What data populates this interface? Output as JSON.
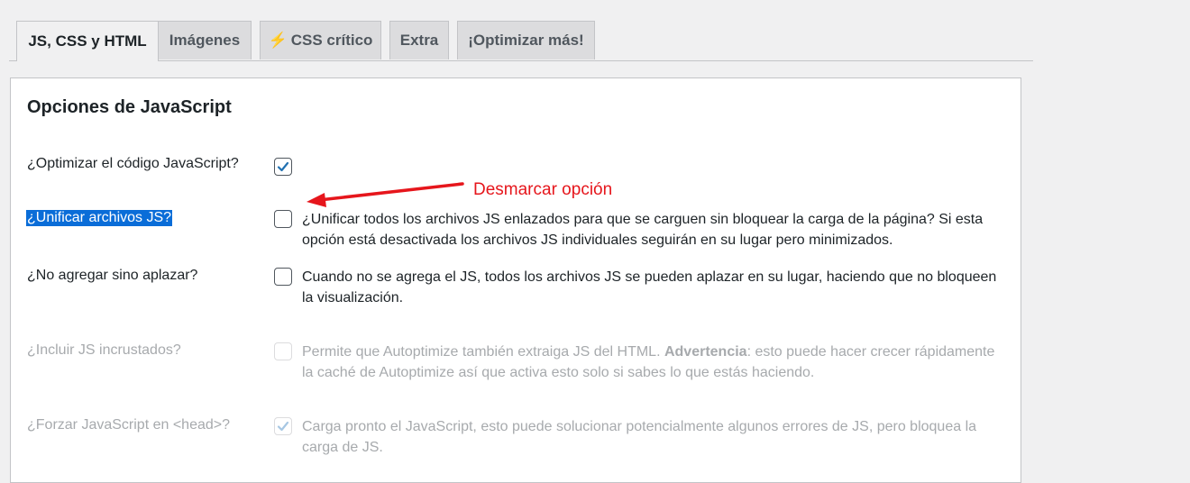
{
  "tabs": [
    {
      "label": "JS, CSS y HTML",
      "active": true
    },
    {
      "label": "Imágenes",
      "active": false
    },
    {
      "label": "CSS crítico",
      "icon": "lightning-bolt-icon",
      "active": false
    },
    {
      "label": "Extra",
      "active": false
    },
    {
      "label": "¡Optimizar más!",
      "active": false
    }
  ],
  "panel": {
    "title": "Opciones de JavaScript",
    "options": [
      {
        "label": "¿Optimizar el código JavaScript?",
        "checked": true,
        "disabled": false,
        "description": ""
      },
      {
        "label": "¿Unificar archivos JS?",
        "checked": false,
        "disabled": false,
        "selected": true,
        "description": "¿Unificar todos los archivos JS enlazados para que se carguen sin bloquear la carga de la página? Si esta opción está desactivada los archivos JS individuales seguirán en su lugar pero minimizados."
      },
      {
        "label": "¿No agregar sino aplazar?",
        "checked": false,
        "disabled": false,
        "description": "Cuando no se agrega el JS, todos los archivos JS se pueden aplazar en su lugar, haciendo que no bloqueen la visualización."
      },
      {
        "label": "¿Incluir JS incrustados?",
        "checked": false,
        "disabled": true,
        "description_before": "Permite que Autoptimize también extraiga JS del HTML. ",
        "description_bold": "Advertencia",
        "description_after": ": esto puede hacer crecer rápidamente la caché de Autoptimize así que activa esto solo si sabes lo que estás haciendo."
      },
      {
        "label": "¿Forzar JavaScript en <head>?",
        "checked": true,
        "disabled": true,
        "description": "Carga pronto el JavaScript, esto puede solucionar potencialmente algunos errores de JS, pero bloquea la carga de JS."
      }
    ]
  },
  "annotation": {
    "text": "Desmarcar opción",
    "color": "#e6161c"
  },
  "colors": {
    "accent": "#2271b1",
    "selection": "#0a6dd8",
    "disabled": "#a7aaad"
  }
}
